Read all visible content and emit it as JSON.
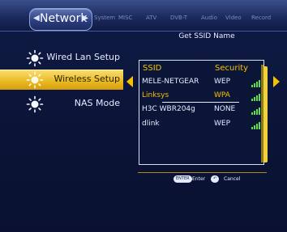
{
  "header": {
    "active_tab": "Network",
    "tabs": [
      "System",
      "MISC",
      "ATV",
      "DVB-T",
      "Audio",
      "Video",
      "Record"
    ]
  },
  "menu": {
    "items": [
      {
        "label": "Wired Lan Setup",
        "selected": false
      },
      {
        "label": "Wireless Setup",
        "selected": true
      },
      {
        "label": "NAS Mode",
        "selected": false
      }
    ]
  },
  "panel": {
    "title": "Get SSID Name",
    "col_ssid": "SSID",
    "col_security": "Security",
    "networks": [
      {
        "ssid": "MELE-NETGEAR",
        "security": "WEP",
        "selected": false
      },
      {
        "ssid": "Linksys",
        "security": "WPA",
        "selected": true
      },
      {
        "ssid": "H3C WBR204g",
        "security": "NONE",
        "selected": false
      },
      {
        "ssid": "dlink",
        "security": "WEP",
        "selected": false
      }
    ]
  },
  "hints": {
    "enter_key": "ENTER",
    "enter_label": "Enter",
    "cancel_key": "↶",
    "cancel_label": "Cancel"
  },
  "colors": {
    "accent": "#f5c200",
    "highlight": "#e9b820",
    "signal": "#5fe04a"
  }
}
